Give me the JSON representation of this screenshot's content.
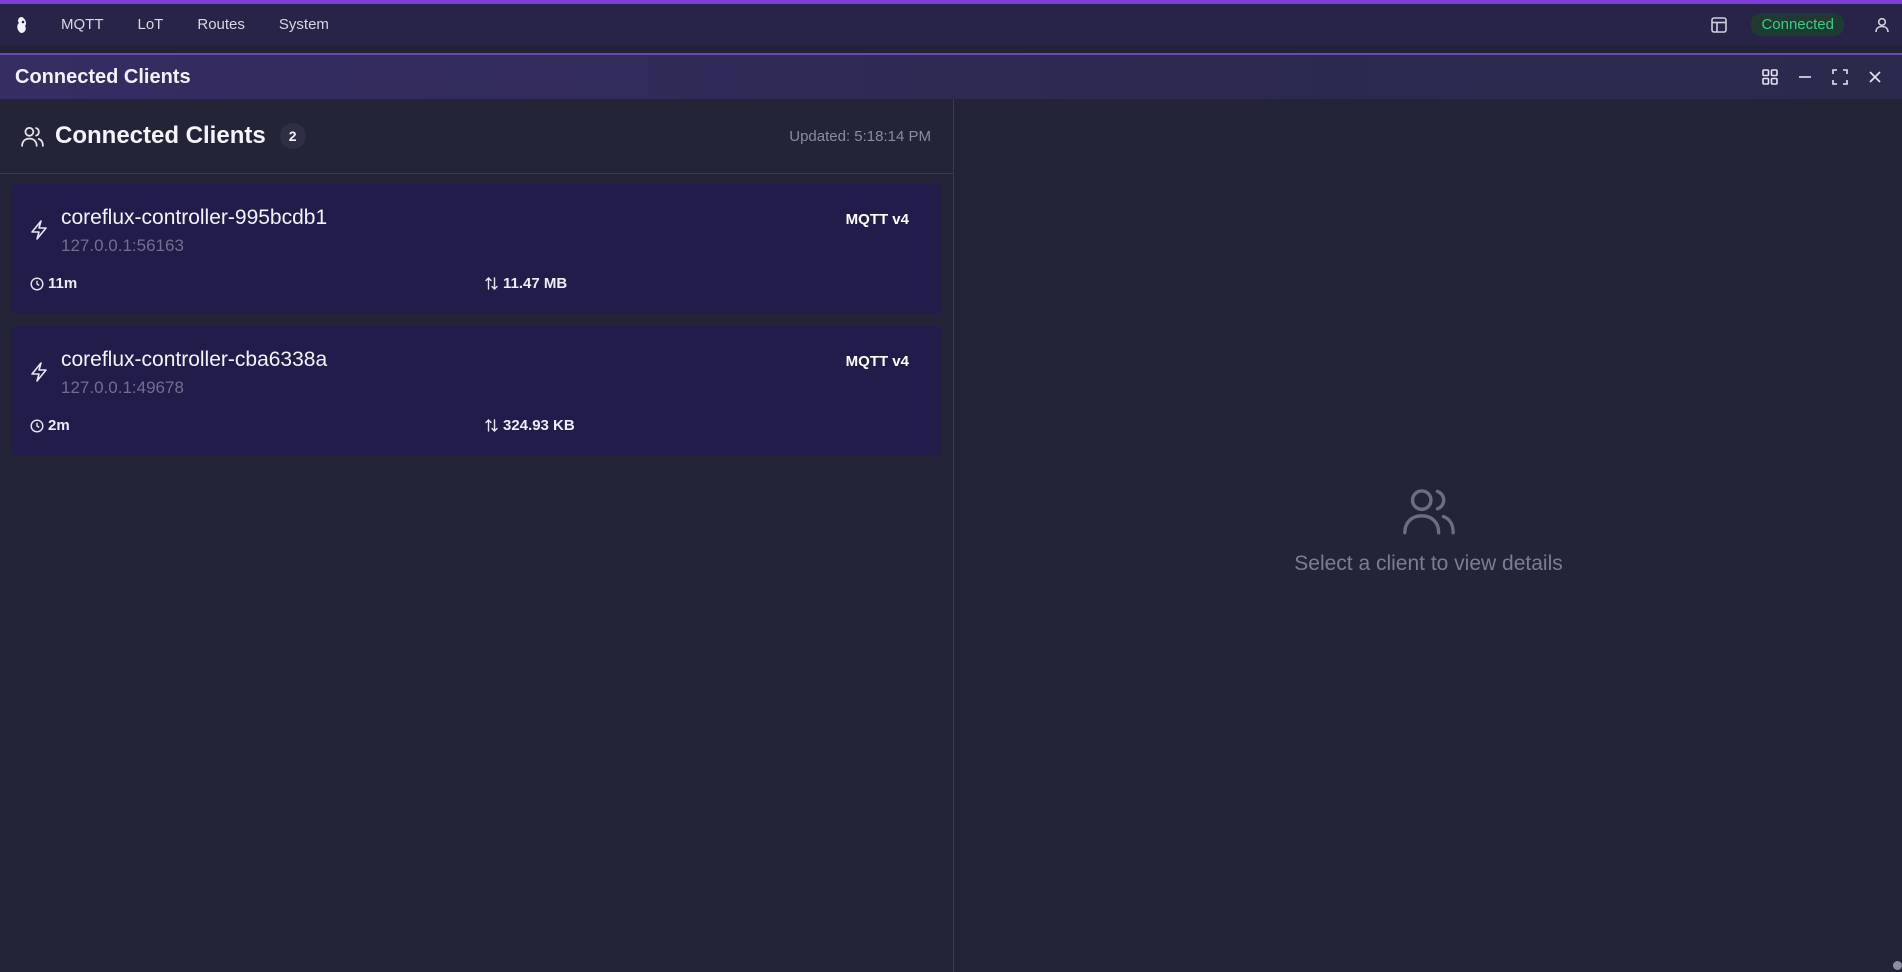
{
  "nav": {
    "items": [
      {
        "label": "MQTT"
      },
      {
        "label": "LoT"
      },
      {
        "label": "Routes"
      },
      {
        "label": "System"
      }
    ],
    "status": "Connected",
    "status_color": "#35d07f"
  },
  "window": {
    "title": "Connected Clients"
  },
  "clients_panel": {
    "title": "Connected Clients",
    "count": "2",
    "updated": "Updated: 5:18:14 PM",
    "clients": [
      {
        "name": "coreflux-controller-995bcdb1",
        "address": "127.0.0.1:56163",
        "protocol": "MQTT v4",
        "uptime": "11m",
        "data": "11.47 MB"
      },
      {
        "name": "coreflux-controller-cba6338a",
        "address": "127.0.0.1:49678",
        "protocol": "MQTT v4",
        "uptime": "2m",
        "data": "324.93 KB"
      }
    ]
  },
  "details_panel": {
    "empty_text": "Select a client to view details"
  },
  "colors": {
    "accent": "#7b3fd6",
    "card_bg": "#221c4b",
    "background": "#222339"
  }
}
